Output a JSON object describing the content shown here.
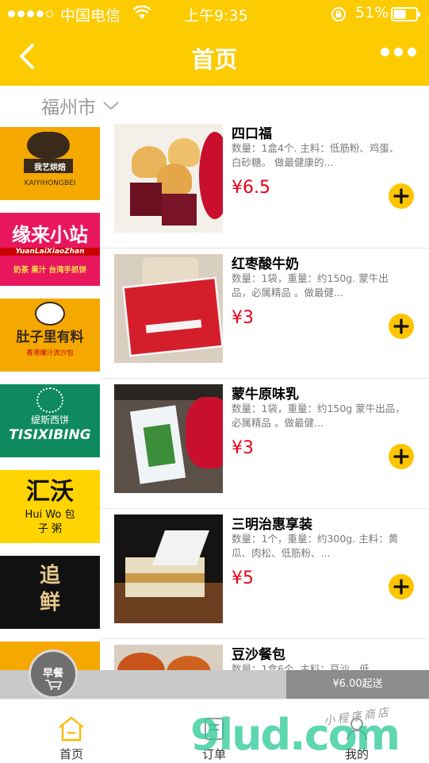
{
  "statusbar": {
    "carrier": "中国电信",
    "time": "上午9:35",
    "battery": "51%"
  },
  "navbar": {
    "title": "首页",
    "back_icon": "chevron-left-icon",
    "more_icon": "more-dots-icon"
  },
  "location": {
    "city": "福州市"
  },
  "shops": [
    {
      "name": "我艺烘焙",
      "subtitle": "KAIYIHONGBEI",
      "color": "#f5a800"
    },
    {
      "name": "缘来小站",
      "subtitle": "奶茶 果汁 台湾手抓饼",
      "color": "#e8175d"
    },
    {
      "name": "肚子里有料",
      "subtitle": "香港爆汁流沙包",
      "color": "#f5a800"
    },
    {
      "name": "缇斯西饼",
      "subtitle": "TISIXIBING",
      "color": "#0e8a5e"
    },
    {
      "name": "汇沃",
      "subtitle": "Hui Wo 包子 粥",
      "color": "#ffd400"
    },
    {
      "name": "追鲜",
      "subtitle": "",
      "color": "#111111"
    },
    {
      "name": "",
      "subtitle": "",
      "color": "#f5a800"
    }
  ],
  "products": [
    {
      "name": "四口福",
      "desc": "数量：1盒4个. 主料：低筋粉、鸡蛋、白砂糖。 做最健康的...",
      "price": "¥6.5"
    },
    {
      "name": "红枣酸牛奶",
      "desc": "数量：1袋，重量：约150g. 蒙牛出品，必属精品 。做最健...",
      "price": "¥3"
    },
    {
      "name": "蒙牛原味乳",
      "desc": "数量：1袋，重量：约150g 蒙牛出品，必属精品 。做最健...",
      "price": "¥3"
    },
    {
      "name": "三明治惠享装",
      "desc": "数量：1个，重量：约300g. 主料：黄瓜、肉松、低筋粉、...",
      "price": "¥5"
    },
    {
      "name": "豆沙餐包",
      "desc": "数量：1盒6个. 主料：豆沙、低...",
      "price": ""
    }
  ],
  "cart": {
    "min_order": "¥6.00起送",
    "badge": "早餐"
  },
  "tabs": [
    {
      "label": "首页",
      "icon": "home-icon"
    },
    {
      "label": "订单",
      "icon": "order-icon"
    },
    {
      "label": "我的",
      "icon": "profile-icon"
    }
  ],
  "watermark": {
    "text": "9lud.com",
    "tagline": "小程序商店"
  },
  "colors": {
    "accent": "#fccb00",
    "price": "#e8001b"
  }
}
